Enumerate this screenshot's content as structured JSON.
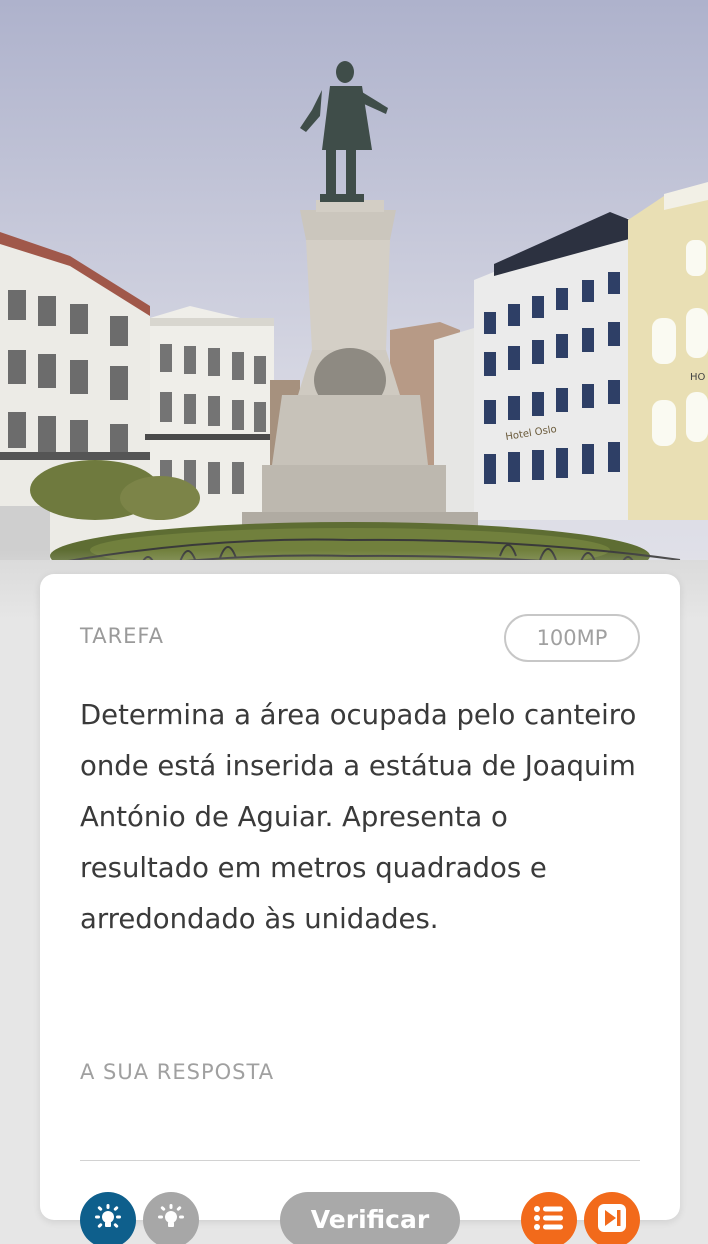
{
  "photo": {
    "sign_text": "Hotel Oslo",
    "corner_text": "HO"
  },
  "card": {
    "label": "TAREFA",
    "points": "100MP",
    "task_text": "Determina a área ocupada pelo canteiro onde está inserida a estátua de Joaquim António de Aguiar. Apresenta o resultado em metros quadrados e arredondado às unidades.",
    "answer_label": "A SUA RESPOSTA",
    "answer_value": ""
  },
  "toolbar": {
    "verify_label": "Verificar",
    "hint_primary_icon": "lightbulb-icon",
    "hint_secondary_icon": "lightbulb-icon",
    "list_icon": "list-icon",
    "skip_icon": "skip-next-icon"
  },
  "colors": {
    "hint_primary": "#0e5f8c",
    "hint_secondary": "#a7a7a7",
    "accent_orange": "#f26a1b",
    "verify_disabled": "#a9a9a9"
  }
}
